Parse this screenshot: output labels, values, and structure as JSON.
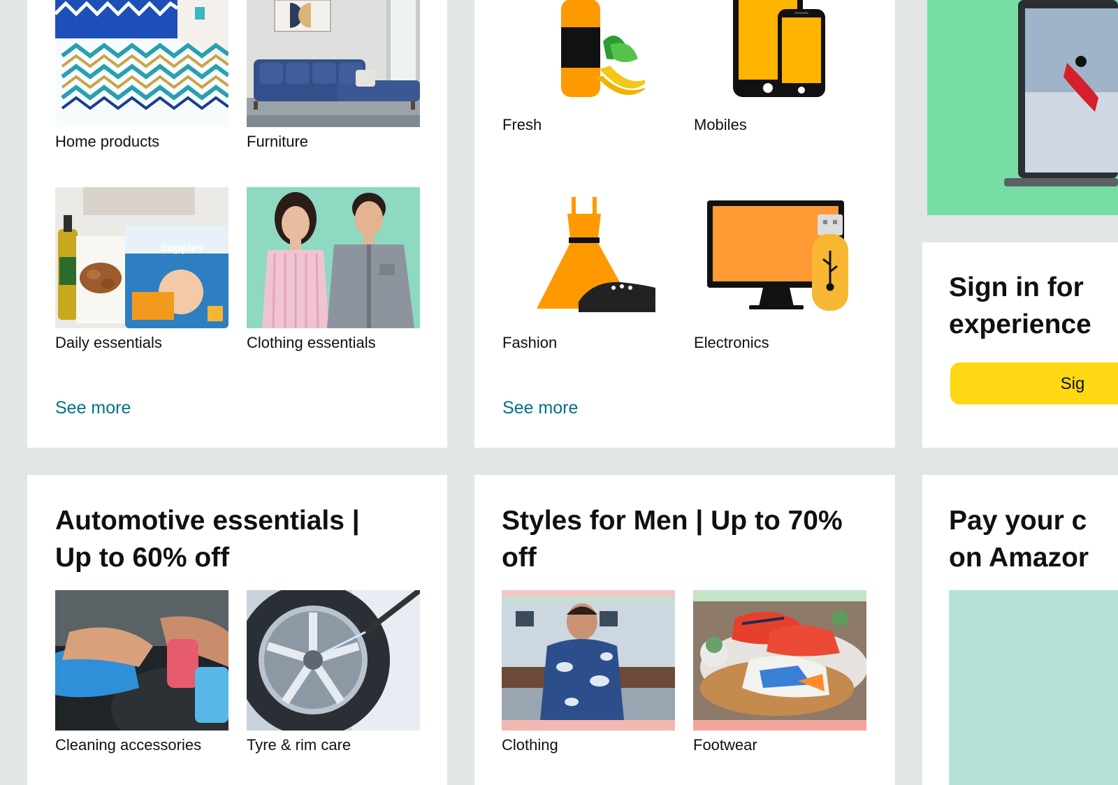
{
  "card_home": {
    "tiles": [
      {
        "label": "Home products",
        "icon": "bedding-photo"
      },
      {
        "label": "Furniture",
        "icon": "sofa-photo"
      },
      {
        "label": "Daily essentials",
        "icon": "diapers-almonds-photo"
      },
      {
        "label": "Clothing essentials",
        "icon": "couple-clothing-photo"
      }
    ],
    "see_more": "See more"
  },
  "card_categories": {
    "tiles": [
      {
        "label": "Fresh",
        "icon": "bottle-banana-icon"
      },
      {
        "label": "Mobiles",
        "icon": "phones-icon"
      },
      {
        "label": "Fashion",
        "icon": "dress-shoe-icon"
      },
      {
        "label": "Electronics",
        "icon": "monitor-usb-icon"
      }
    ],
    "see_more": "See more"
  },
  "card_signin": {
    "title_line1": "Sign in for",
    "title_line2": "experience",
    "button_label": "Sig"
  },
  "card_automotive": {
    "title_line1": "Automotive essentials |",
    "title_line2": "Up to 60% off",
    "tiles": [
      {
        "label": "Cleaning accessories",
        "icon": "car-cleaning-photo"
      },
      {
        "label": "Tyre & rim care",
        "icon": "rim-wash-photo"
      }
    ]
  },
  "card_men": {
    "title_line1": "Styles for Men | Up to 70%",
    "title_line2": "off",
    "tiles": [
      {
        "label": "Clothing",
        "icon": "man-jacket-photo"
      },
      {
        "label": "Footwear",
        "icon": "sneakers-photo"
      }
    ]
  },
  "card_pay": {
    "title_line1": "Pay your c",
    "title_line2": "on Amazor"
  },
  "colors": {
    "page_bg": "#e3e6e6",
    "link": "#007185",
    "button": "#ffd814",
    "icon_orange": "#ff9900"
  }
}
